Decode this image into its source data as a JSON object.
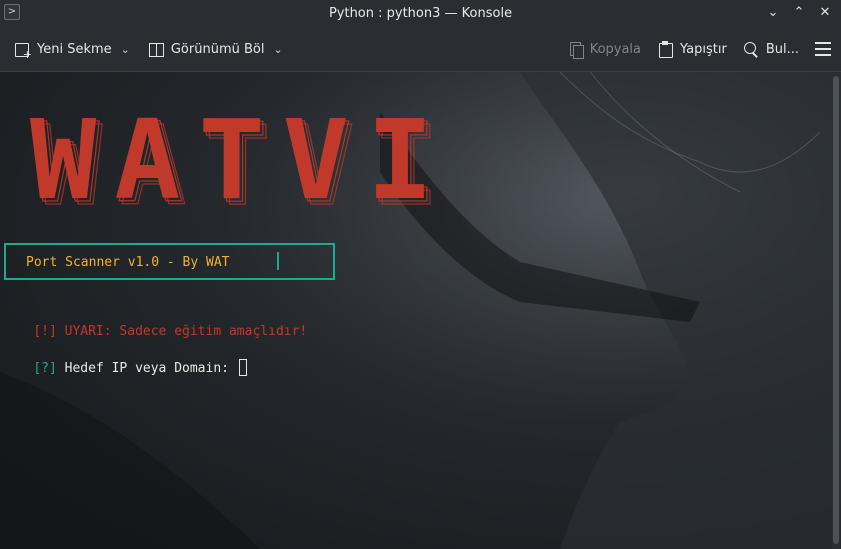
{
  "window": {
    "title": "Python : python3 — Konsole",
    "app_icon_glyph": ">",
    "controls": {
      "minimize": "⌄",
      "maximize": "⌃",
      "close": "✕"
    }
  },
  "toolbar": {
    "new_tab_label": "Yeni Sekme",
    "new_tab_caret": "⌄",
    "split_view_label": "Görünümü Böl",
    "split_view_caret": "⌄",
    "copy_label": "Kopyala",
    "paste_label": "Yapıştır",
    "find_label": "Bul..."
  },
  "terminal": {
    "banner_text": "WATVI",
    "banner_color": "#c0392b",
    "box_title": "Port Scanner v1.0 - By WAT",
    "warning_prefix": "[!]",
    "warning_text": " UYARI: Sadece eğitim amaçlıdır!",
    "prompt_prefix": "[?]",
    "prompt_text": " Hedef IP veya Domain: "
  },
  "colors": {
    "accent_teal": "#1fa98e",
    "accent_yellow": "#f0b429",
    "warning_red": "#c0392b"
  }
}
